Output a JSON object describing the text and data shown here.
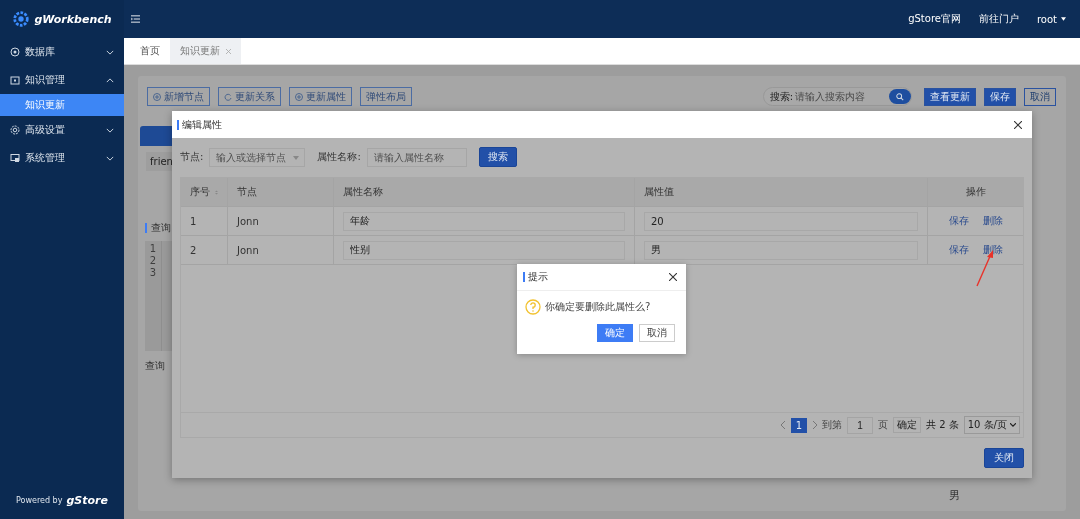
{
  "header": {
    "brand": "gWorkbench",
    "links": [
      "gStore官网",
      "前往门户"
    ],
    "user": "root"
  },
  "sidebar": {
    "items": [
      {
        "label": "数据库",
        "expanded": false
      },
      {
        "label": "知识管理",
        "expanded": true,
        "children": [
          {
            "label": "知识更新",
            "selected": true
          }
        ]
      },
      {
        "label": "高级设置",
        "expanded": false
      },
      {
        "label": "系统管理",
        "expanded": false
      }
    ],
    "powered_by": "Powered by",
    "logo_text": "gStore"
  },
  "tabs": [
    {
      "label": "首页",
      "selected": false,
      "closable": false
    },
    {
      "label": "知识更新",
      "selected": true,
      "closable": true
    }
  ],
  "toolbar": {
    "buttons": [
      "新增节点",
      "更新关系",
      "更新属性",
      "弹性布局"
    ],
    "search": {
      "label": "搜索:",
      "placeholder": "请输入搜索内容"
    },
    "actions": [
      "查看更新",
      "保存",
      "取消"
    ]
  },
  "left_panel": {
    "tag_text": "frien",
    "section_title": "查询",
    "line_numbers": [
      "1",
      "2",
      "3"
    ],
    "footer_text": "查询"
  },
  "value_text": "男",
  "edit_dialog": {
    "title": "编辑属性",
    "filters": [
      {
        "label": "节点:",
        "placeholder": "输入或选择节点",
        "kind": "select"
      },
      {
        "label": "属性名称:",
        "placeholder": "请输入属性名称",
        "kind": "input"
      }
    ],
    "search_button": "搜索",
    "table": {
      "columns": [
        "序号",
        "节点",
        "属性名称",
        "属性值",
        "操作"
      ],
      "rows": [
        {
          "index": "1",
          "node": "Jonn",
          "name": "年龄",
          "value": "20",
          "actions": [
            "保存",
            "删除"
          ]
        },
        {
          "index": "2",
          "node": "Jonn",
          "name": "性别",
          "value": "男",
          "actions": [
            "保存",
            "删除"
          ]
        }
      ]
    },
    "pagination": {
      "pages": [
        {
          "label": "1",
          "selected": true
        }
      ],
      "goto_label": "到第",
      "goto_value": "1",
      "page_unit": "页",
      "confirm": "确定",
      "total": "共 2 条",
      "page_size": "10 条/页"
    },
    "close_button": "关闭"
  },
  "confirm_dialog": {
    "title": "提示",
    "message": "你确定要删除此属性么?",
    "ok": "确定",
    "cancel": "取消"
  }
}
